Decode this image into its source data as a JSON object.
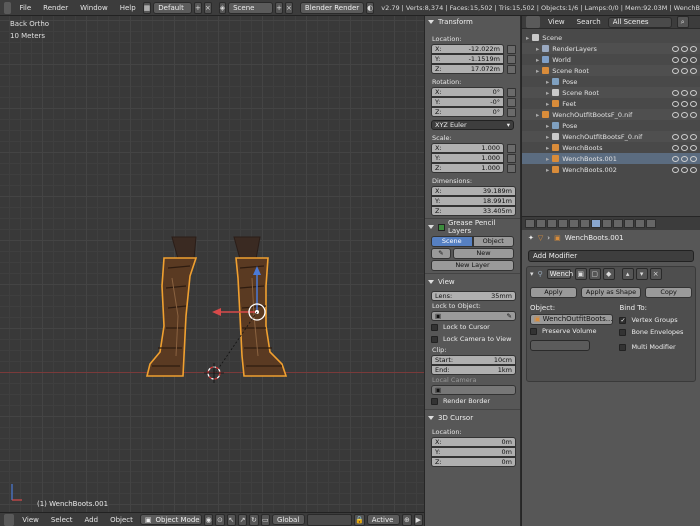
{
  "topbar": {
    "menus": [
      "File",
      "Render",
      "Window",
      "Help"
    ],
    "layout": "Default",
    "scene": "Scene",
    "engine": "Blender Render",
    "stats": "v2.79 | Verts:8,374 | Faces:15,502 | Tris:15,502 | Objects:1/6 | Lamps:0/0 | Mem:92.03M | WenchB"
  },
  "viewport": {
    "view_label": "Back Ortho",
    "scale_label": "10 Meters",
    "object_label": "(1) WenchBoots.001"
  },
  "bottombar": {
    "menus": [
      "View",
      "Select",
      "Add",
      "Object"
    ],
    "mode": "Object Mode",
    "orientation": "Global",
    "layer_state": "Active"
  },
  "npanel": {
    "transform_title": "Transform",
    "location_label": "Location:",
    "location": [
      {
        "axis": "X:",
        "value": "-12.022m"
      },
      {
        "axis": "Y:",
        "value": "-1.1519m"
      },
      {
        "axis": "Z:",
        "value": "17.072m"
      }
    ],
    "rotation_label": "Rotation:",
    "rotation": [
      {
        "axis": "X:",
        "value": "0°"
      },
      {
        "axis": "Y:",
        "value": "-0°"
      },
      {
        "axis": "Z:",
        "value": "0°"
      }
    ],
    "rotation_mode": "XYZ Euler",
    "scale_label": "Scale:",
    "scale": [
      {
        "axis": "X:",
        "value": "1.000"
      },
      {
        "axis": "Y:",
        "value": "1.000"
      },
      {
        "axis": "Z:",
        "value": "1.000"
      }
    ],
    "dimensions_label": "Dimensions:",
    "dimensions": [
      {
        "axis": "X:",
        "value": "39.189m"
      },
      {
        "axis": "Y:",
        "value": "18.991m"
      },
      {
        "axis": "Z:",
        "value": "33.405m"
      }
    ],
    "grease_title": "Grease Pencil Layers",
    "grease_scene": "Scene",
    "grease_object": "Object",
    "grease_new": "New",
    "grease_new_layer": "New Layer",
    "view_title": "View",
    "lens_label": "Lens:",
    "lens_value": "35mm",
    "lock_object_label": "Lock to Object:",
    "lock_cursor": "Lock to Cursor",
    "lock_camera": "Lock Camera to View",
    "clip_label": "Clip:",
    "clip_start_label": "Start:",
    "clip_start": "10cm",
    "clip_end_label": "End:",
    "clip_end": "1km",
    "local_camera": "Local Camera",
    "render_border": "Render Border",
    "cursor_title": "3D Cursor",
    "cursor_location_label": "Location:",
    "cursor": [
      {
        "axis": "X:",
        "value": "0m"
      },
      {
        "axis": "Y:",
        "value": "0m"
      },
      {
        "axis": "Z:",
        "value": "0m"
      }
    ]
  },
  "outliner": {
    "view_menu": "View",
    "search_menu": "Search",
    "filter": "All Scenes",
    "rows": [
      {
        "label": "Scene",
        "indent": 0,
        "color": "#c9c9c9"
      },
      {
        "label": "RenderLayers",
        "indent": 1,
        "color": "#9aa9c0"
      },
      {
        "label": "World",
        "indent": 1,
        "color": "#7f9fc7"
      },
      {
        "label": "Scene Root",
        "indent": 1,
        "color": "#d98c3a"
      },
      {
        "label": "Pose",
        "indent": 2,
        "color": "#7fa0c0"
      },
      {
        "label": "Scene Root",
        "indent": 2,
        "color": "#c9c9c9"
      },
      {
        "label": "Feet",
        "indent": 2,
        "color": "#d98c3a"
      },
      {
        "label": "WenchOutfitBootsF_0.nif",
        "indent": 1,
        "color": "#d98c3a"
      },
      {
        "label": "Pose",
        "indent": 2,
        "color": "#7fa0c0"
      },
      {
        "label": "WenchOutfitBootsF_0.nif",
        "indent": 2,
        "color": "#c9c9c9"
      },
      {
        "label": "WenchBoots",
        "indent": 2,
        "color": "#d98c3a"
      },
      {
        "label": "WenchBoots.001",
        "indent": 2,
        "color": "#d98c3a"
      },
      {
        "label": "WenchBoots.002",
        "indent": 2,
        "color": "#d98c3a"
      }
    ]
  },
  "props": {
    "breadcrumb": "WenchBoots.001",
    "add_modifier": "Add Modifier",
    "modifier_name": "Wench",
    "apply": "Apply",
    "apply_shape": "Apply as Shape",
    "copy": "Copy",
    "object_label": "Object:",
    "object_value": "WenchOutfitBoots...",
    "bind_label": "Bind To:",
    "vertex_groups": "Vertex Groups",
    "preserve_volume": "Preserve Volume",
    "bone_envelopes": "Bone Envelopes",
    "multi_modifier": "Multi Modifier"
  },
  "colors": {
    "selection_outline": "#f0a030",
    "accent_blue": "#5680c2"
  }
}
